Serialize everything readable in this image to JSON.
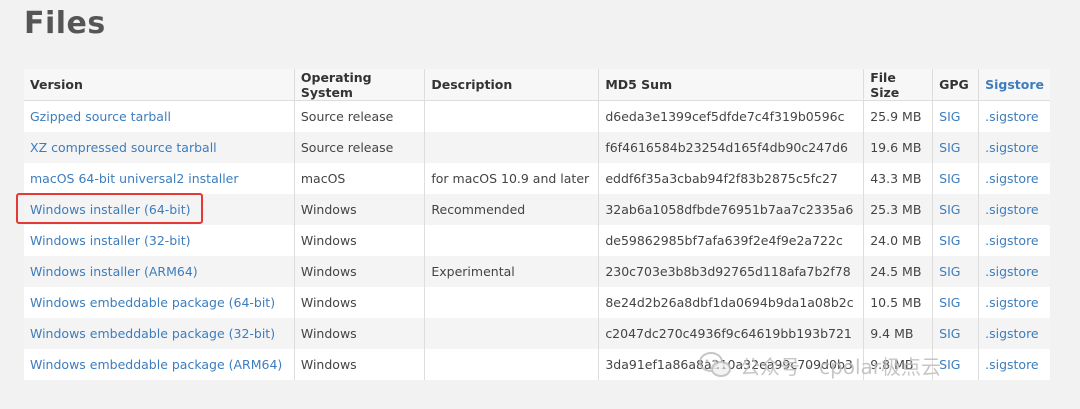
{
  "page": {
    "title": "Files"
  },
  "table": {
    "headers": {
      "version": "Version",
      "os": "Operating System",
      "description": "Description",
      "md5": "MD5 Sum",
      "size": "File Size",
      "gpg": "GPG",
      "sigstore": "Sigstore"
    },
    "rows": [
      {
        "version": "Gzipped source tarball",
        "os": "Source release",
        "description": "",
        "md5": "d6eda3e1399cef5dfde7c4f319b0596c",
        "size": "25.9 MB",
        "gpg": "SIG",
        "sigstore": ".sigstore"
      },
      {
        "version": "XZ compressed source tarball",
        "os": "Source release",
        "description": "",
        "md5": "f6f4616584b23254d165f4db90c247d6",
        "size": "19.6 MB",
        "gpg": "SIG",
        "sigstore": ".sigstore"
      },
      {
        "version": "macOS 64-bit universal2 installer",
        "os": "macOS",
        "description": "for macOS 10.9 and later",
        "md5": "eddf6f35a3cbab94f2f83b2875c5fc27",
        "size": "43.3 MB",
        "gpg": "SIG",
        "sigstore": ".sigstore"
      },
      {
        "version": "Windows installer (64-bit)",
        "os": "Windows",
        "description": "Recommended",
        "md5": "32ab6a1058dfbde76951b7aa7c2335a6",
        "size": "25.3 MB",
        "gpg": "SIG",
        "sigstore": ".sigstore"
      },
      {
        "version": "Windows installer (32-bit)",
        "os": "Windows",
        "description": "",
        "md5": "de59862985bf7afa639f2e4f9e2a722c",
        "size": "24.0 MB",
        "gpg": "SIG",
        "sigstore": ".sigstore"
      },
      {
        "version": "Windows installer (ARM64)",
        "os": "Windows",
        "description": "Experimental",
        "md5": "230c703e3b8b3d92765d118afa7b2f78",
        "size": "24.5 MB",
        "gpg": "SIG",
        "sigstore": ".sigstore"
      },
      {
        "version": "Windows embeddable package (64-bit)",
        "os": "Windows",
        "description": "",
        "md5": "8e24d2b26a8dbf1da0694b9da1a08b2c",
        "size": "10.5 MB",
        "gpg": "SIG",
        "sigstore": ".sigstore"
      },
      {
        "version": "Windows embeddable package (32-bit)",
        "os": "Windows",
        "description": "",
        "md5": "c2047dc270c4936f9c64619bb193b721",
        "size": "9.4 MB",
        "gpg": "SIG",
        "sigstore": ".sigstore"
      },
      {
        "version": "Windows embeddable package (ARM64)",
        "os": "Windows",
        "description": "",
        "md5": "3da91ef1a86a8a210a32ea99c709d0b3",
        "size": "9.8 MB",
        "gpg": "SIG",
        "sigstore": ".sigstore"
      }
    ]
  },
  "watermark": {
    "text": "公众号 · cpolar极点云"
  },
  "colors": {
    "link": "#3d7dbd",
    "highlight": "#e53935",
    "title": "#555555"
  }
}
